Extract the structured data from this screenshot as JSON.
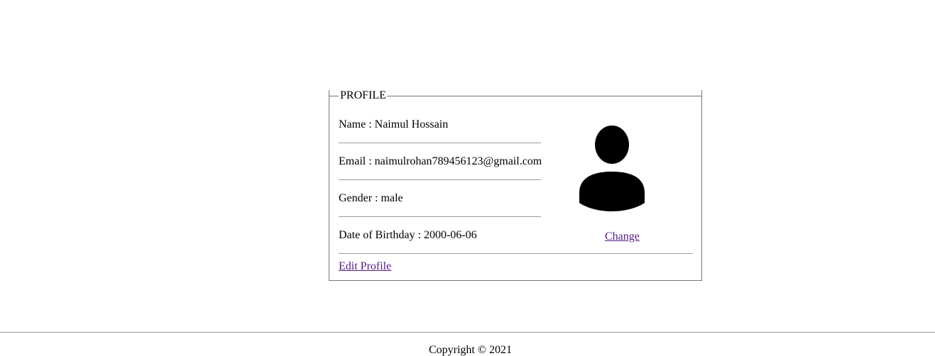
{
  "profile": {
    "legend": "PROFILE",
    "name_line": "Name : Naimul Hossain",
    "email_line": "Email : naimulrohan789456123@gmail.com",
    "gender_line": "Gender : male",
    "dob_line": "Date of Birthday : 2000-06-06",
    "change_label": "Change",
    "edit_label": "Edit Profile",
    "avatar_icon": "user-silhouette-icon"
  },
  "footer": {
    "copyright": "Copyright © 2021"
  },
  "colors": {
    "link": "#551a8b",
    "border": "#767676",
    "rule": "#9a9a9a"
  }
}
